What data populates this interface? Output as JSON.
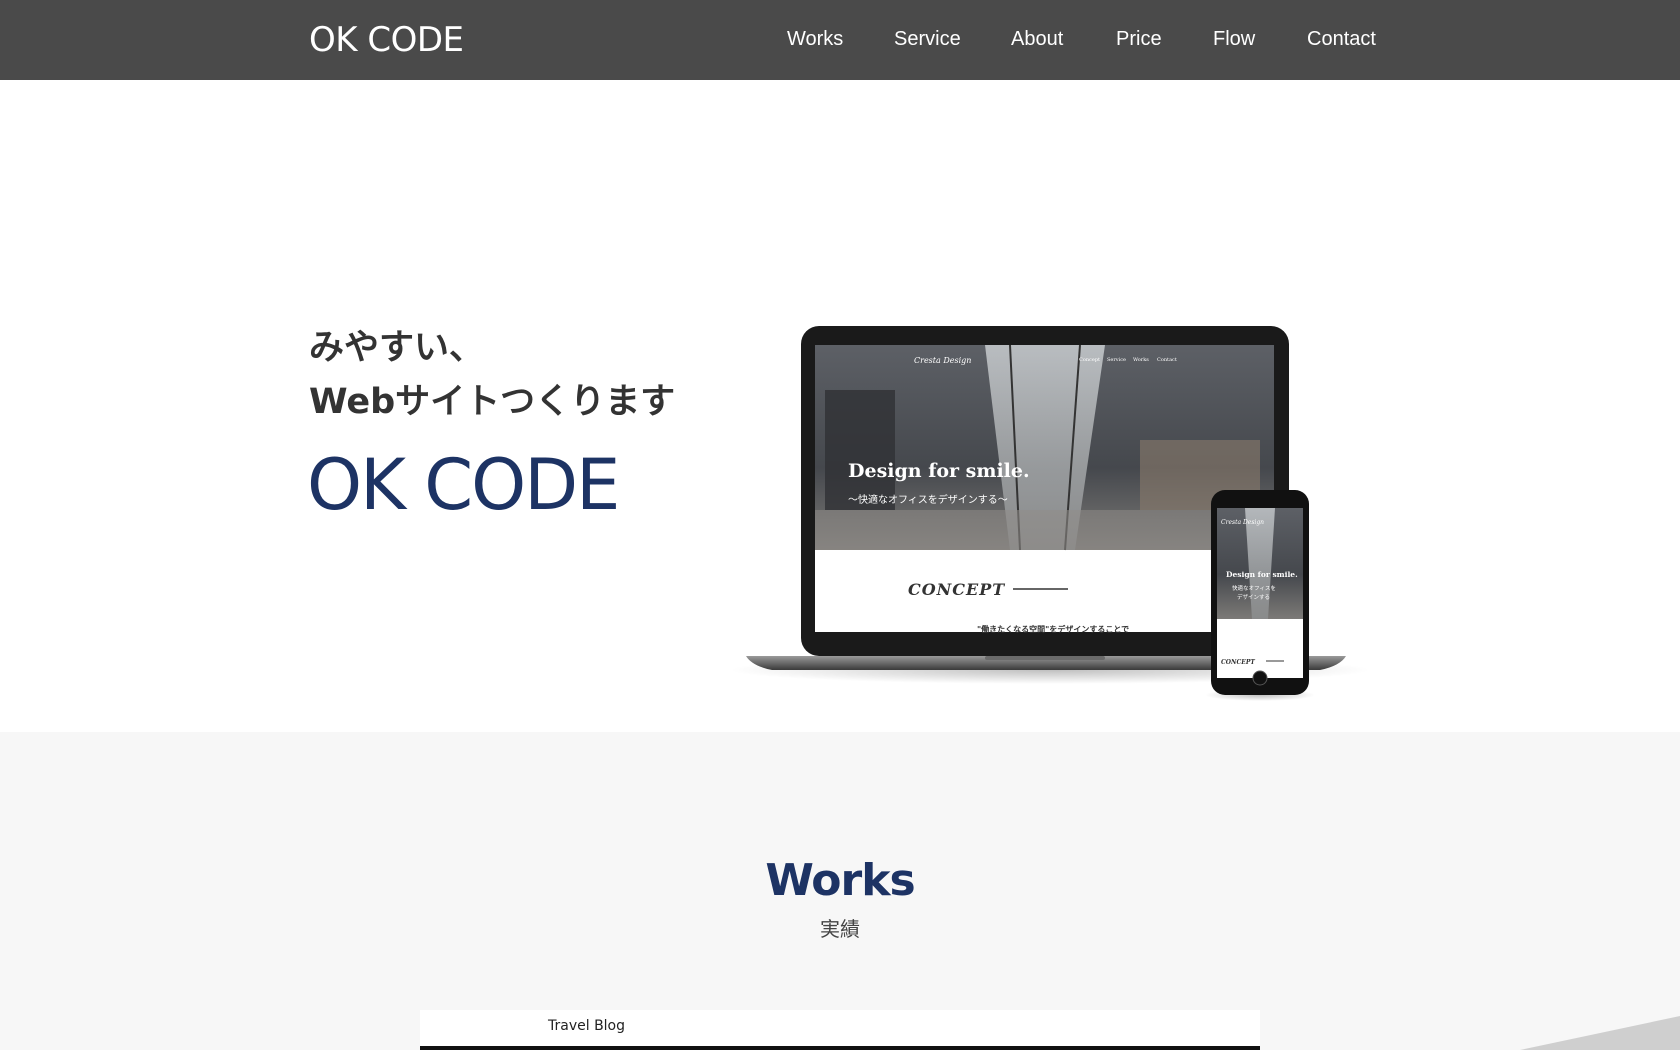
{
  "header": {
    "logo": "OK CODE",
    "nav": [
      "Works",
      "Service",
      "About",
      "Price",
      "Flow",
      "Contact"
    ]
  },
  "hero": {
    "line1": "みやすい、",
    "line2": "Webサイトつくります",
    "brand": "OK CODE"
  },
  "mockup": {
    "laptop_site_name": "Cresta Design",
    "laptop_nav": [
      "Concept",
      "Service",
      "Works",
      "Contact"
    ],
    "headline": "Design for smile.",
    "subline": "〜快適なオフィスをデザインする〜",
    "concept": "CONCEPT",
    "concept_text": "\"働きたくなる空間\"をデザインすることで",
    "phone_site_name": "Cresta Design",
    "phone_headline": "Design for smile.",
    "phone_subline1": "快適なオフィスを",
    "phone_subline2": "デザインする",
    "phone_concept": "CONCEPT"
  },
  "works": {
    "title": "Works",
    "subtitle": "実績",
    "card_label": "Travel Blog"
  },
  "colors": {
    "header_bg": "#4a4a4a",
    "brand_navy": "#1d3364",
    "section_bg": "#f7f7f7"
  }
}
